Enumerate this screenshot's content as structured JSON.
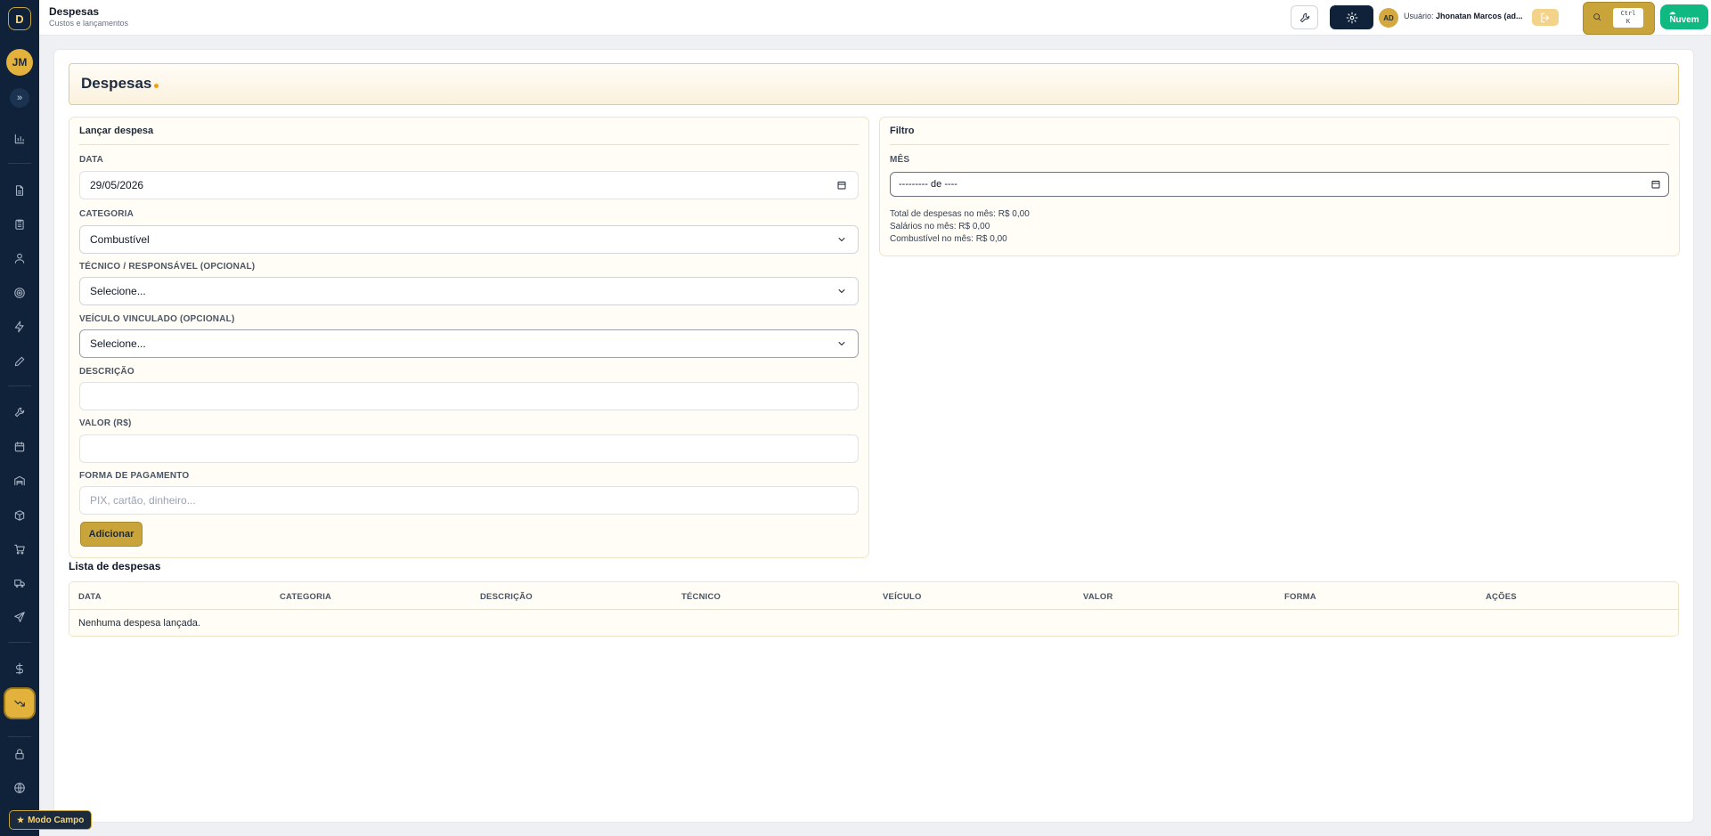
{
  "app": {
    "logo_letter": "D",
    "user_initials": "JM",
    "expand_glyph": "»"
  },
  "header": {
    "title": "Despesas",
    "subtitle": "Custos e lançamentos",
    "admin_initials": "AD",
    "user_label": "Usuário:",
    "user_name": "Jhonatan Marcos (ad...",
    "shortcut_line1": "Ctrl",
    "shortcut_line2": "K",
    "cloud_label": "Nuvem"
  },
  "sidebar": {
    "items": [
      {
        "icon": "bar-chart-icon"
      },
      {
        "icon": "document-icon"
      },
      {
        "icon": "clipboard-icon"
      },
      {
        "icon": "user-icon"
      },
      {
        "icon": "target-icon"
      },
      {
        "icon": "bolt-icon"
      },
      {
        "icon": "pencil-icon"
      },
      {
        "icon": "wrench-icon"
      },
      {
        "icon": "calendar-icon"
      },
      {
        "icon": "warehouse-icon"
      },
      {
        "icon": "box-icon"
      },
      {
        "icon": "cart-icon"
      },
      {
        "icon": "truck-icon"
      },
      {
        "icon": "send-icon"
      },
      {
        "icon": "dollar-icon"
      },
      {
        "icon": "trending-down-icon",
        "active": true
      },
      {
        "icon": "lock-icon"
      },
      {
        "icon": "globe-icon"
      }
    ],
    "mode_button": "Modo Campo"
  },
  "page": {
    "title": "Despesas"
  },
  "form": {
    "title": "Lançar despesa",
    "date_label": "DATA",
    "date_value": "29/05/2026",
    "category_label": "CATEGORIA",
    "category_value": "Combustível",
    "technician_label": "TÉCNICO / RESPONSÁVEL (OPCIONAL)",
    "technician_value": "Selecione...",
    "vehicle_label": "VEÍCULO VINCULADO (OPCIONAL)",
    "vehicle_value": "Selecione...",
    "description_label": "DESCRIÇÃO",
    "description_value": "",
    "amount_label": "VALOR (R$)",
    "amount_value": "",
    "payment_label": "FORMA DE PAGAMENTO",
    "payment_placeholder": "PIX, cartão, dinheiro...",
    "submit_label": "Adicionar"
  },
  "filter": {
    "title": "Filtro",
    "month_label": "MÊS",
    "month_value": "--------- de ----",
    "total_line": "Total de despesas no mês: R$ 0,00",
    "salaries_line": "Salários no mês: R$ 0,00",
    "fuel_line": "Combustível no mês: R$ 0,00"
  },
  "list": {
    "title": "Lista de despesas",
    "columns": [
      "DATA",
      "CATEGORIA",
      "DESCRIÇÃO",
      "TÉCNICO",
      "VEÍCULO",
      "VALOR",
      "FORMA",
      "AÇÕES"
    ],
    "empty_message": "Nenhuma despesa lançada."
  },
  "colors": {
    "brand_gold": "#c9a43a",
    "sidebar_navy": "#0f2239",
    "cloud_green": "#10b981"
  }
}
